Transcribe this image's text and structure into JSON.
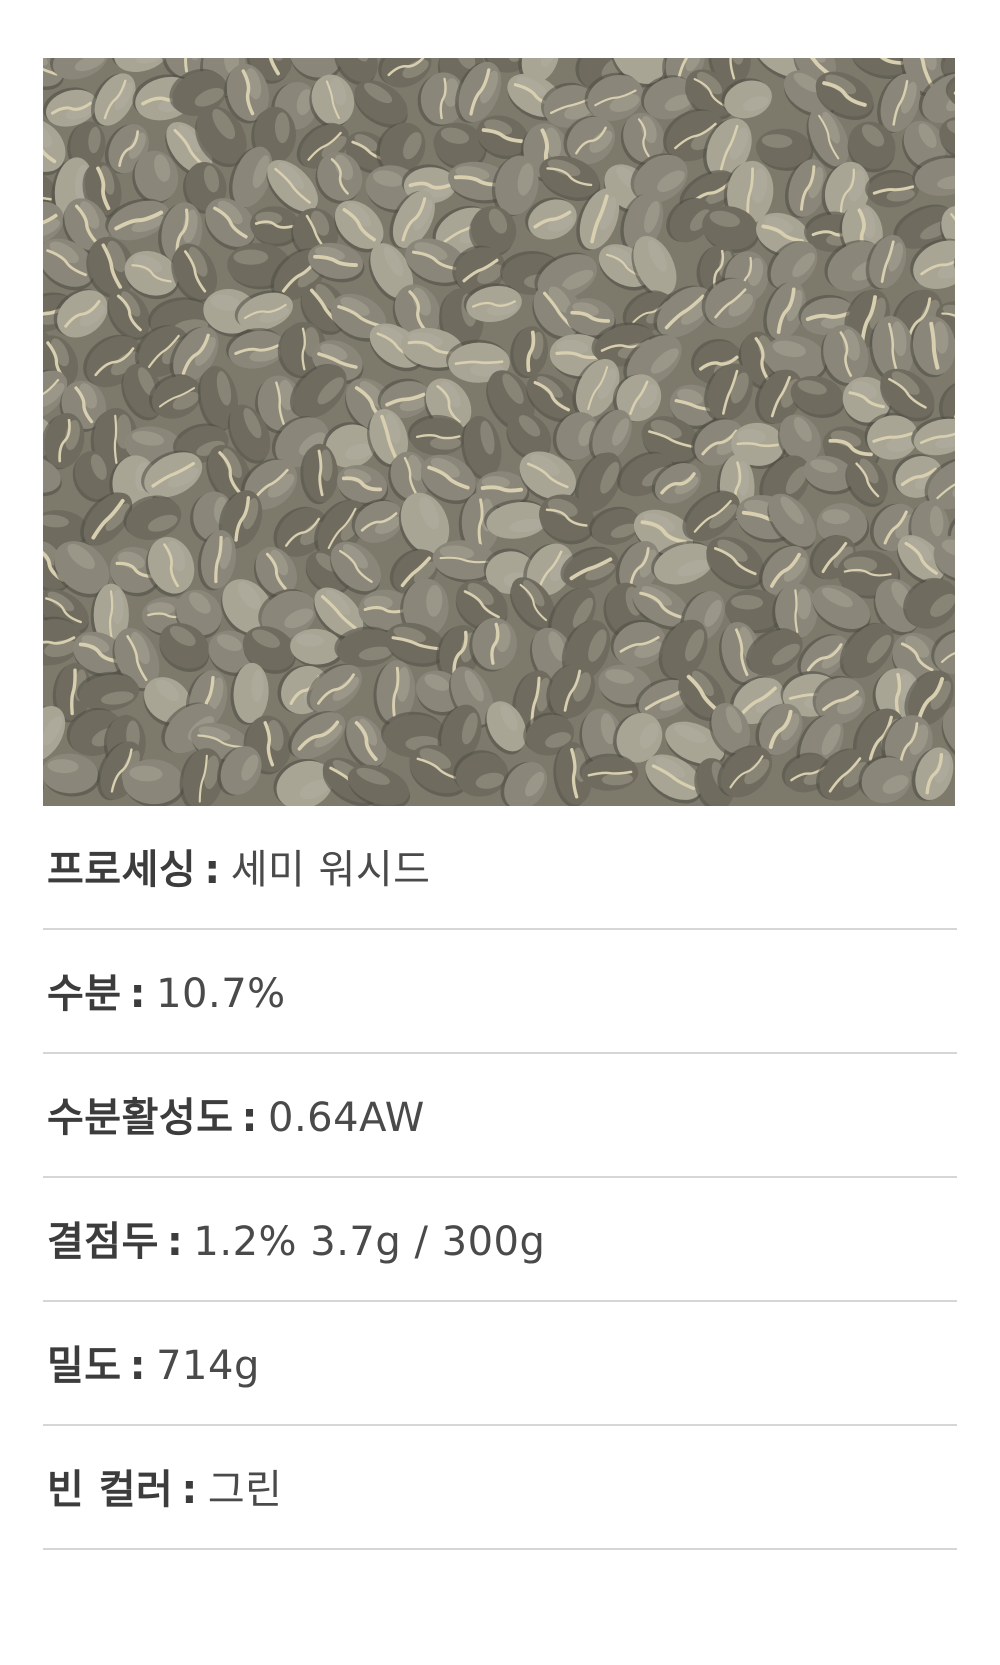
{
  "image": {
    "subject": "green-coffee-beans-photo",
    "colors": {
      "bean_dark": "#6f6c5f",
      "bean_mid": "#8a877a",
      "bean_light": "#a8a595",
      "crease": "#d8cfb0",
      "background": "#7d7a6c"
    }
  },
  "specs": [
    {
      "label": "프로세싱",
      "separator": ":",
      "value": "세미 워시드"
    },
    {
      "label": "수분",
      "separator": ":",
      "value": "10.7%"
    },
    {
      "label": "수분활성도",
      "separator": ":",
      "value": "0.64AW"
    },
    {
      "label": "결점두",
      "separator": ":",
      "value": "1.2% 3.7g / 300g"
    },
    {
      "label": "밀도",
      "separator": ":",
      "value": "714g"
    },
    {
      "label": "빈 컬러",
      "separator": ":",
      "value": "그린"
    }
  ]
}
